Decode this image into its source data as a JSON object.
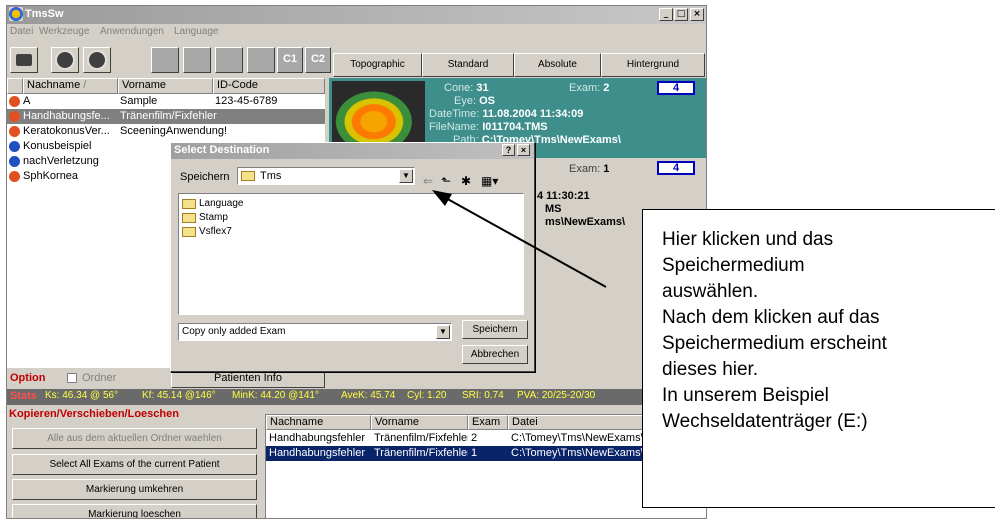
{
  "window": {
    "title": "TmsSw"
  },
  "menu": [
    "Datei",
    "Werkzeuge",
    "Anwendungen",
    "Language"
  ],
  "toolbar": {
    "c1": "C1",
    "c2": "C2",
    "views": [
      "Topographic",
      "Standard",
      "Absolute",
      "Hintergrund"
    ]
  },
  "patients": {
    "headers": [
      "Nachname",
      "Vorname",
      "ID-Code"
    ],
    "sort_marker": "/",
    "rows": [
      {
        "last": "A",
        "first": "Sample",
        "id": "123-45-6789",
        "color": "#e05020"
      },
      {
        "last": "Handhabungsfe...",
        "first": "Tränenfilm/Fixfehler",
        "id": "",
        "color": "#e05020"
      },
      {
        "last": "KeratokonusVer...",
        "first": "SceeningAnwendung!",
        "id": "",
        "color": "#e05020"
      },
      {
        "last": "Konusbeispiel",
        "first": "",
        "id": "",
        "color": "#2050c0"
      },
      {
        "last": "nachVerletzung",
        "first": "",
        "id": "",
        "color": "#2050c0"
      },
      {
        "last": "SphKornea",
        "first": "",
        "id": "",
        "color": "#e05020"
      }
    ]
  },
  "exam1": {
    "cone_label": "Cone:",
    "cone": "31",
    "exam_label": "Exam:",
    "exam": "2",
    "eye_label": "Eye:",
    "eye": "OS",
    "datetime_label": "DateTime:",
    "datetime": "11.08.2004 11:34:09",
    "filename_label": "FileName:",
    "filename": "I011704.TMS",
    "path_label": "Path:",
    "path": "C:\\Tomey\\Tms\\NewExams\\",
    "box": "4"
  },
  "exam2": {
    "exam_label": "Exam:",
    "exam": "1",
    "datetime_partial": "4 11:30:21",
    "filename_partial": "MS",
    "path_partial": "ms\\NewExams\\",
    "box": "4"
  },
  "option": {
    "label": "Option",
    "checkbox_label": "Ordner",
    "patient_info": "Patienten Info"
  },
  "stats": {
    "label": "Stats",
    "items": [
      "Ks: 46.34 @ 56°",
      "Kf: 45.14 @146°",
      "MinK: 44.20 @141°",
      "AveK: 45.74",
      "Cyl: 1.20",
      "SRI: 0.74",
      "PVA: 20/25-20/30"
    ]
  },
  "kopieren": {
    "title": "Kopieren/Verschieben/Loeschen",
    "buttons": [
      "Alle aus dem aktuellen Ordner waehlen",
      "Select All Exams of the current Patient",
      "Markierung umkehren",
      "Markierung loeschen"
    ]
  },
  "exam_table": {
    "headers": [
      "Nachname",
      "Vorname",
      "Exam",
      "Datei"
    ],
    "rows": [
      [
        "Handhabungsfehler",
        "Tränenfilm/Fixfehler",
        "2",
        "C:\\Tomey\\Tms\\NewExams\\"
      ],
      [
        "Handhabungsfehler",
        "Tränenfilm/Fixfehler",
        "1",
        "C:\\Tomey\\Tms\\NewExams\\"
      ]
    ]
  },
  "dialog": {
    "title": "Select Destination",
    "help": "?",
    "close": "×",
    "save_in_label": "Speichern",
    "location": "Tms",
    "folders": [
      "Language",
      "Stamp",
      "Vsflex7"
    ],
    "copy_option": "Copy only added Exam",
    "save_button": "Speichern",
    "cancel_button": "Abbrechen"
  },
  "callout": {
    "lines": [
      "Hier klicken und das",
      "Speichermedium",
      "auswählen.",
      "Nach dem klicken auf das",
      "Speichermedium erscheint",
      "dieses hier.",
      "In unserem Beispiel",
      "Wechseldatenträger (E:)"
    ]
  }
}
